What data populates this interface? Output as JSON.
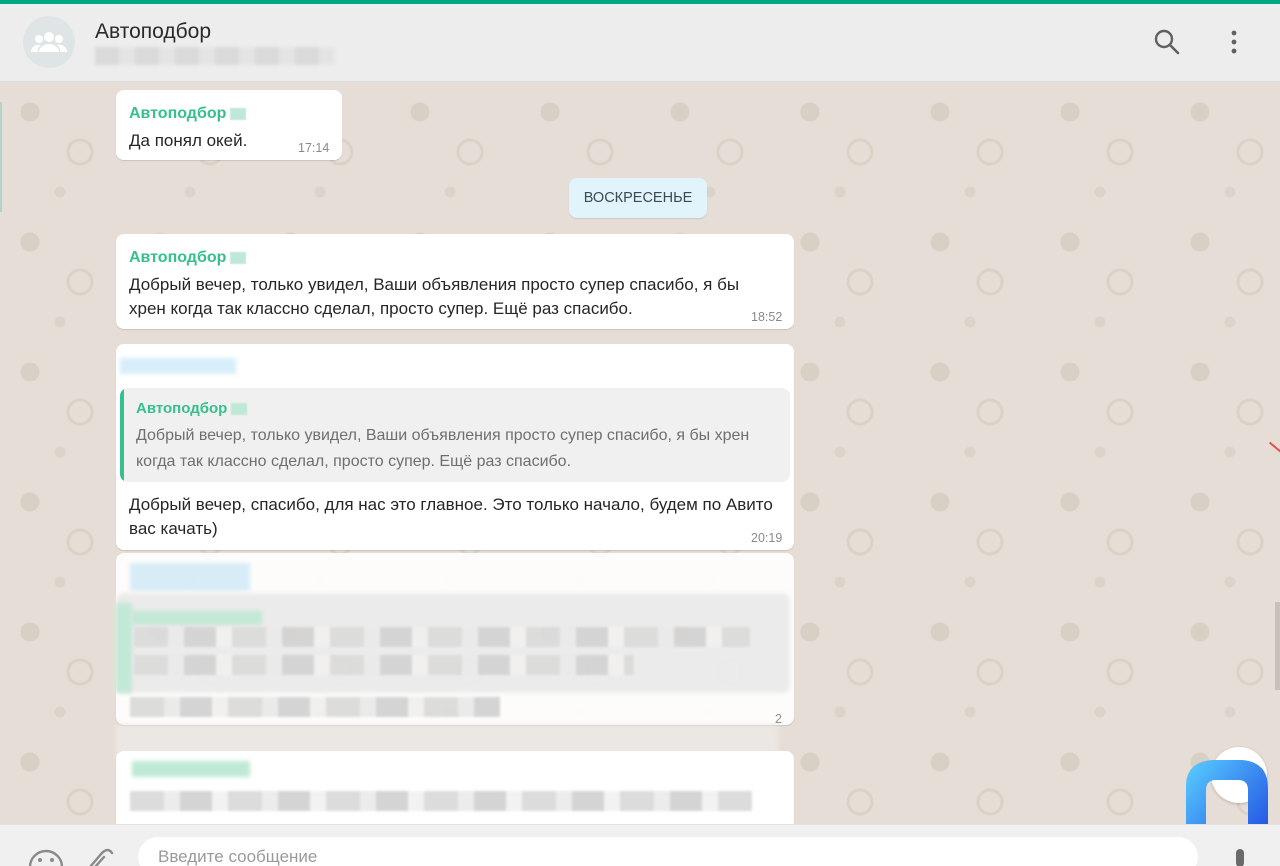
{
  "header": {
    "title": "Автоподбор",
    "search_icon": "search-icon",
    "menu_icon": "more-vertical-icon",
    "avatar_icon": "group-icon"
  },
  "messages": [
    {
      "sender": "Автоподбор",
      "text": "Да понял окей.",
      "time": "17:14"
    },
    {
      "sender": "Автоподбор",
      "text": "Добрый вечер, только увидел, Ваши объявления просто супер спасибо, я бы хрен когда так классно сделал, просто супер. Ещё раз спасибо.",
      "time": "18:52"
    },
    {
      "quote_sender": "Автоподбор",
      "quote_text": "Добрый вечер, только увидел, Ваши объявления просто супер спасибо, я бы хрен когда так классно сделал, просто супер. Ещё раз спасибо.",
      "text": "Добрый вечер, спасибо, для нас это главное. Это только начало, будем по Авито вас качать)",
      "time": "20:19"
    }
  ],
  "day_divider": "ВОСКРЕСЕНЬЕ",
  "partial_time": "2",
  "footer": {
    "placeholder": "Введите сообщение",
    "emoji_icon": "emoji-icon",
    "attach_icon": "paperclip-icon",
    "mic_icon": "microphone-icon"
  },
  "colors": {
    "accent": "#00a884",
    "sender": "#35c08e",
    "day_pill": "#e1f3fb",
    "background": "#e5ddd5"
  }
}
